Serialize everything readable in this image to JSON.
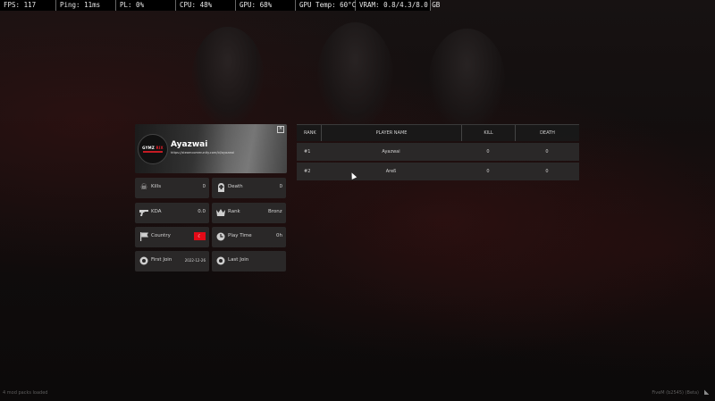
{
  "perf": {
    "fps": "FPS: 117",
    "ping": "Ping: 11ms",
    "pl": "PL: 0%",
    "cpu": "CPU: 48%",
    "gpu": "GPU: 68%",
    "gpu_temp": "GPU Temp: 60°C",
    "vram": "VRAM: 0.8/4.3/8.0 GB"
  },
  "profile": {
    "name": "Ayazwai",
    "url": "https://steamcommunity.com/id/ayazwai",
    "logo_left": "GYMZ",
    "logo_right": "RIX",
    "close_glyph": "×"
  },
  "stats": {
    "kills_label": "Kills",
    "kills_value": "0",
    "death_label": "Death",
    "death_value": "0",
    "kda_label": "KDA",
    "kda_value": "0.0",
    "rank_label": "Rank",
    "rank_value": "Bronze",
    "country_label": "Country",
    "playtime_label": "Play Time",
    "playtime_value": "0h",
    "firstjoin_label": "First Join",
    "firstjoin_value": "2022-12-26",
    "lastjoin_label": "Last Join",
    "lastjoin_value": ""
  },
  "leaderboard": {
    "headers": {
      "rank": "RANK",
      "name": "PLAYER NAME",
      "kill": "KILL",
      "death": "DEATH"
    },
    "rows": [
      {
        "rank": "#1",
        "name": "Ayazwai",
        "kill": "0",
        "death": "0"
      },
      {
        "rank": "#2",
        "name": "Areß",
        "kill": "0",
        "death": "0"
      }
    ]
  },
  "footer": {
    "left": "4 mod packs loaded",
    "right": "FiveM (b2545) (Beta)"
  },
  "colors": {
    "flag_red": "#e30a17",
    "tile_bg": "#2a2828"
  }
}
